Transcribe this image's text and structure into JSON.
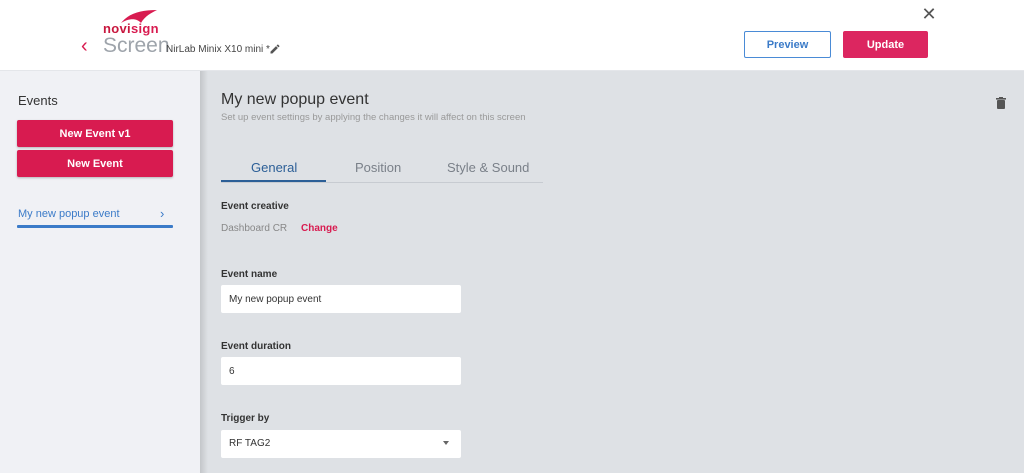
{
  "header": {
    "logo": {
      "part1": "novi",
      "part2": "sign"
    },
    "screen_title": "Screen",
    "device_name": "NirLab Minix X10 mini *",
    "preview_label": "Preview",
    "update_label": "Update",
    "close_glyph": "✕",
    "back_glyph": "‹"
  },
  "sidebar": {
    "title": "Events",
    "buttons": [
      "New Event v1",
      "New Event"
    ],
    "items": [
      {
        "label": "My new popup event",
        "chevron": "›"
      }
    ]
  },
  "main": {
    "title": "My new popup event",
    "subtitle": "Set up event settings by applying the changes it will affect on this screen",
    "tabs": [
      "General",
      "Position",
      "Style & Sound"
    ],
    "active_tab": "General",
    "fields": {
      "creative_label": "Event creative",
      "creative_value": "Dashboard CR",
      "change_label": "Change",
      "name_label": "Event name",
      "name_value": "My new popup event",
      "duration_label": "Event duration",
      "duration_value": "6",
      "trigger_label": "Trigger by",
      "trigger_value": "RF TAG2"
    }
  },
  "colors": {
    "accent": "#d81b50",
    "link_blue": "#3b7bc8",
    "tab_active": "#2c5f97",
    "sidebar_bg": "#f0f1f5",
    "main_bg": "#dee1e5"
  },
  "icons": [
    "logo-swoosh-icon",
    "back-chevron-icon",
    "pencil-icon",
    "close-icon",
    "chevron-right-icon",
    "trash-icon",
    "dropdown-arrow-icon"
  ]
}
